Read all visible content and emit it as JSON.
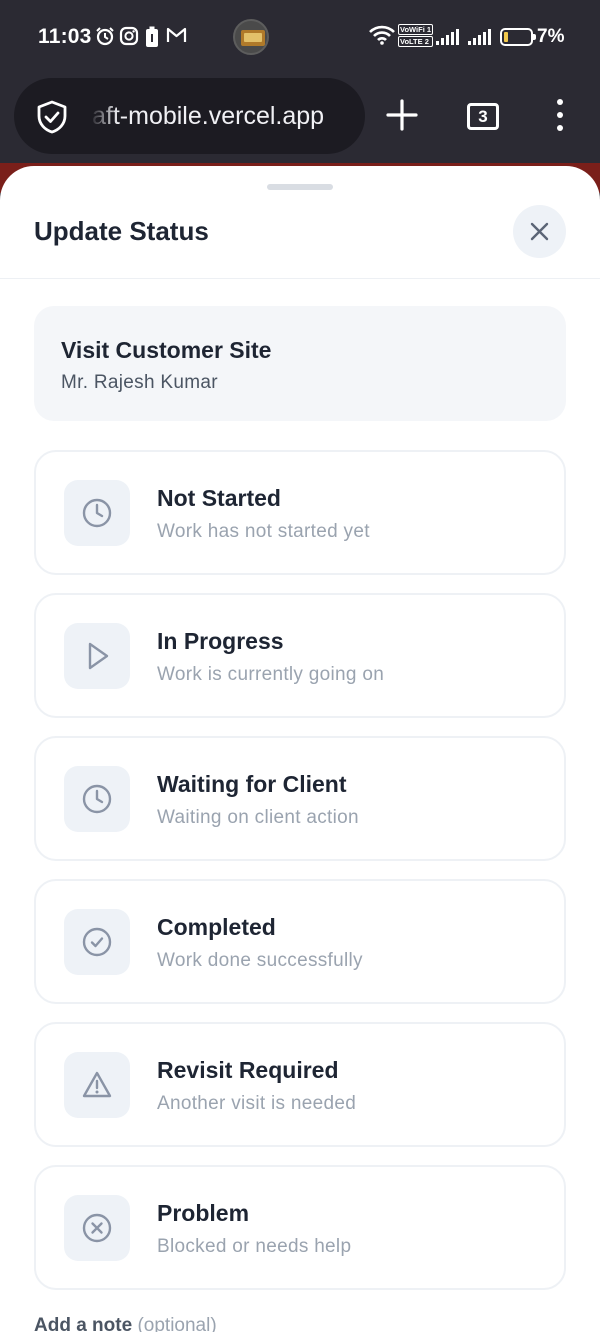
{
  "status_bar": {
    "time": "11:03",
    "battery_percent": "7%",
    "battery_level": 0.07,
    "network_tags": [
      "VoWiFi 1",
      "VoLTE 2"
    ],
    "icons": [
      "alarm-icon",
      "instagram-icon",
      "battery-saver-icon",
      "gmail-icon",
      "wifi-icon",
      "signal-icon"
    ]
  },
  "browser": {
    "url": "aft-mobile.vercel.app",
    "tab_count": "3",
    "icons": [
      "shield-icon",
      "plus-icon",
      "menu-icon"
    ]
  },
  "sheet": {
    "title": "Update Status",
    "task": {
      "title": "Visit Customer Site",
      "client": "Mr. Rajesh Kumar"
    },
    "options": [
      {
        "title": "Not Started",
        "description": "Work has not started yet",
        "icon": "clock-icon"
      },
      {
        "title": "In Progress",
        "description": "Work is currently going on",
        "icon": "play-icon"
      },
      {
        "title": "Waiting for Client",
        "description": "Waiting on client action",
        "icon": "clock-icon"
      },
      {
        "title": "Completed",
        "description": "Work done successfully",
        "icon": "check-circle-icon"
      },
      {
        "title": "Revisit Required",
        "description": "Another visit is needed",
        "icon": "warning-icon"
      },
      {
        "title": "Problem",
        "description": "Blocked or needs help",
        "icon": "x-circle-icon"
      }
    ],
    "note": {
      "label": "Add a note",
      "optional": "(optional)"
    }
  },
  "colors": {
    "text_primary": "#1e2533",
    "text_secondary": "#9aa3af",
    "icon_bg": "#eef2f7",
    "icon_stroke": "#8a94a6"
  }
}
